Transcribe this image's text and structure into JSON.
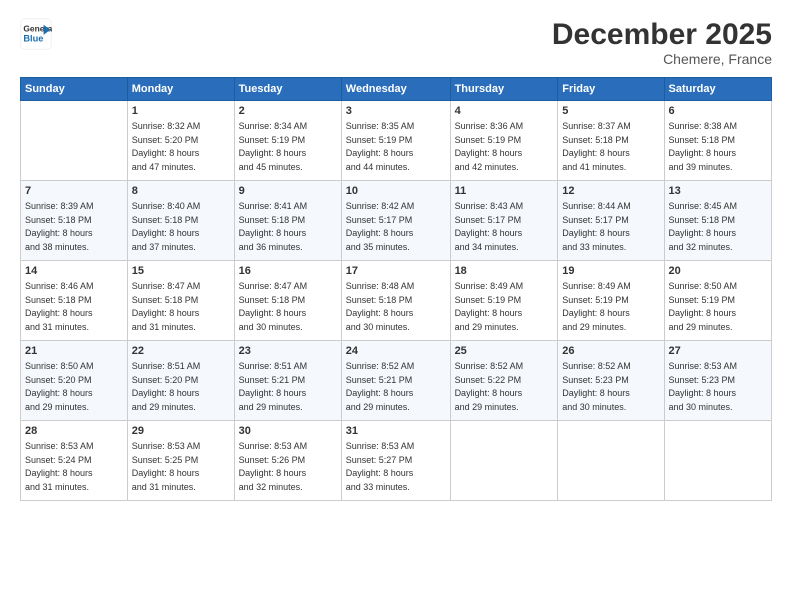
{
  "header": {
    "logo_line1": "General",
    "logo_line2": "Blue",
    "month": "December 2025",
    "location": "Chemere, France"
  },
  "days_header": [
    "Sunday",
    "Monday",
    "Tuesday",
    "Wednesday",
    "Thursday",
    "Friday",
    "Saturday"
  ],
  "weeks": [
    [
      {
        "day": "",
        "detail": ""
      },
      {
        "day": "1",
        "detail": "Sunrise: 8:32 AM\nSunset: 5:20 PM\nDaylight: 8 hours\nand 47 minutes."
      },
      {
        "day": "2",
        "detail": "Sunrise: 8:34 AM\nSunset: 5:19 PM\nDaylight: 8 hours\nand 45 minutes."
      },
      {
        "day": "3",
        "detail": "Sunrise: 8:35 AM\nSunset: 5:19 PM\nDaylight: 8 hours\nand 44 minutes."
      },
      {
        "day": "4",
        "detail": "Sunrise: 8:36 AM\nSunset: 5:19 PM\nDaylight: 8 hours\nand 42 minutes."
      },
      {
        "day": "5",
        "detail": "Sunrise: 8:37 AM\nSunset: 5:18 PM\nDaylight: 8 hours\nand 41 minutes."
      },
      {
        "day": "6",
        "detail": "Sunrise: 8:38 AM\nSunset: 5:18 PM\nDaylight: 8 hours\nand 39 minutes."
      }
    ],
    [
      {
        "day": "7",
        "detail": "Sunrise: 8:39 AM\nSunset: 5:18 PM\nDaylight: 8 hours\nand 38 minutes."
      },
      {
        "day": "8",
        "detail": "Sunrise: 8:40 AM\nSunset: 5:18 PM\nDaylight: 8 hours\nand 37 minutes."
      },
      {
        "day": "9",
        "detail": "Sunrise: 8:41 AM\nSunset: 5:18 PM\nDaylight: 8 hours\nand 36 minutes."
      },
      {
        "day": "10",
        "detail": "Sunrise: 8:42 AM\nSunset: 5:17 PM\nDaylight: 8 hours\nand 35 minutes."
      },
      {
        "day": "11",
        "detail": "Sunrise: 8:43 AM\nSunset: 5:17 PM\nDaylight: 8 hours\nand 34 minutes."
      },
      {
        "day": "12",
        "detail": "Sunrise: 8:44 AM\nSunset: 5:17 PM\nDaylight: 8 hours\nand 33 minutes."
      },
      {
        "day": "13",
        "detail": "Sunrise: 8:45 AM\nSunset: 5:18 PM\nDaylight: 8 hours\nand 32 minutes."
      }
    ],
    [
      {
        "day": "14",
        "detail": "Sunrise: 8:46 AM\nSunset: 5:18 PM\nDaylight: 8 hours\nand 31 minutes."
      },
      {
        "day": "15",
        "detail": "Sunrise: 8:47 AM\nSunset: 5:18 PM\nDaylight: 8 hours\nand 31 minutes."
      },
      {
        "day": "16",
        "detail": "Sunrise: 8:47 AM\nSunset: 5:18 PM\nDaylight: 8 hours\nand 30 minutes."
      },
      {
        "day": "17",
        "detail": "Sunrise: 8:48 AM\nSunset: 5:18 PM\nDaylight: 8 hours\nand 30 minutes."
      },
      {
        "day": "18",
        "detail": "Sunrise: 8:49 AM\nSunset: 5:19 PM\nDaylight: 8 hours\nand 29 minutes."
      },
      {
        "day": "19",
        "detail": "Sunrise: 8:49 AM\nSunset: 5:19 PM\nDaylight: 8 hours\nand 29 minutes."
      },
      {
        "day": "20",
        "detail": "Sunrise: 8:50 AM\nSunset: 5:19 PM\nDaylight: 8 hours\nand 29 minutes."
      }
    ],
    [
      {
        "day": "21",
        "detail": "Sunrise: 8:50 AM\nSunset: 5:20 PM\nDaylight: 8 hours\nand 29 minutes."
      },
      {
        "day": "22",
        "detail": "Sunrise: 8:51 AM\nSunset: 5:20 PM\nDaylight: 8 hours\nand 29 minutes."
      },
      {
        "day": "23",
        "detail": "Sunrise: 8:51 AM\nSunset: 5:21 PM\nDaylight: 8 hours\nand 29 minutes."
      },
      {
        "day": "24",
        "detail": "Sunrise: 8:52 AM\nSunset: 5:21 PM\nDaylight: 8 hours\nand 29 minutes."
      },
      {
        "day": "25",
        "detail": "Sunrise: 8:52 AM\nSunset: 5:22 PM\nDaylight: 8 hours\nand 29 minutes."
      },
      {
        "day": "26",
        "detail": "Sunrise: 8:52 AM\nSunset: 5:23 PM\nDaylight: 8 hours\nand 30 minutes."
      },
      {
        "day": "27",
        "detail": "Sunrise: 8:53 AM\nSunset: 5:23 PM\nDaylight: 8 hours\nand 30 minutes."
      }
    ],
    [
      {
        "day": "28",
        "detail": "Sunrise: 8:53 AM\nSunset: 5:24 PM\nDaylight: 8 hours\nand 31 minutes."
      },
      {
        "day": "29",
        "detail": "Sunrise: 8:53 AM\nSunset: 5:25 PM\nDaylight: 8 hours\nand 31 minutes."
      },
      {
        "day": "30",
        "detail": "Sunrise: 8:53 AM\nSunset: 5:26 PM\nDaylight: 8 hours\nand 32 minutes."
      },
      {
        "day": "31",
        "detail": "Sunrise: 8:53 AM\nSunset: 5:27 PM\nDaylight: 8 hours\nand 33 minutes."
      },
      {
        "day": "",
        "detail": ""
      },
      {
        "day": "",
        "detail": ""
      },
      {
        "day": "",
        "detail": ""
      }
    ]
  ]
}
